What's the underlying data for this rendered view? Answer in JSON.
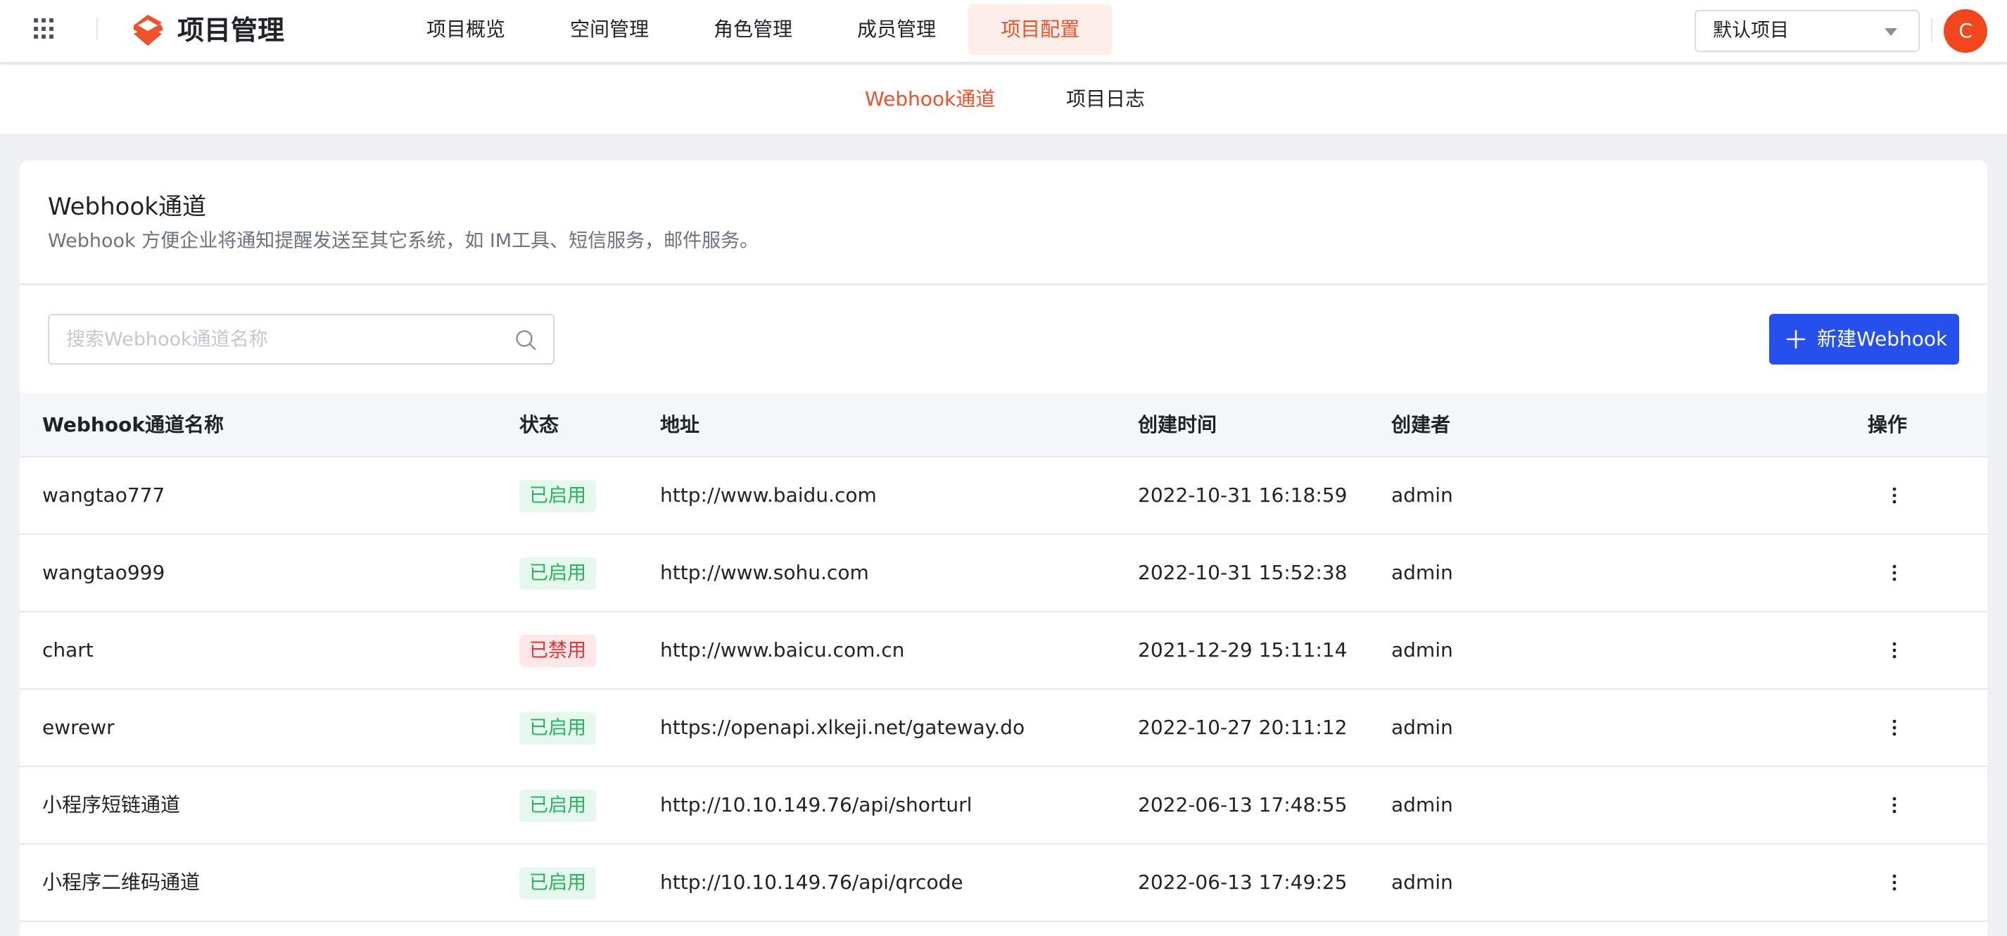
{
  "app": {
    "title": "项目管理",
    "icons": {
      "apps": "apps-grid-icon",
      "logo": "brand-logo-icon"
    },
    "brand_color": "#f0502a",
    "primary_color": "#2550eb"
  },
  "main_nav": [
    {
      "label": "项目概览",
      "active": false
    },
    {
      "label": "空间管理",
      "active": false
    },
    {
      "label": "角色管理",
      "active": false
    },
    {
      "label": "成员管理",
      "active": false
    },
    {
      "label": "项目配置",
      "active": true
    }
  ],
  "project_select": {
    "value": "默认项目",
    "icon": "chevron-down-icon"
  },
  "user": {
    "avatar_letter": "C",
    "avatar_color": "#f2461d"
  },
  "sub_nav": [
    {
      "label": "Webhook通道",
      "active": true
    },
    {
      "label": "项目日志",
      "active": false
    }
  ],
  "page": {
    "title": "Webhook通道",
    "description": "Webhook 方便企业将通知提醒发送至其它系统，如 IM工具、短信服务，邮件服务。"
  },
  "search": {
    "placeholder": "搜索Webhook通道名称",
    "value": "",
    "icon": "search-icon"
  },
  "new_button": {
    "label": "新建Webhook",
    "icon": "plus-icon"
  },
  "table": {
    "columns": [
      "Webhook通道名称",
      "状态",
      "地址",
      "创建时间",
      "创建者",
      "操作"
    ],
    "rows": [
      {
        "name": "wangtao777",
        "status": "已启用",
        "enabled": true,
        "url": "http://www.baidu.com",
        "created": "2022-10-31 16:18:59",
        "creator": "admin"
      },
      {
        "name": "wangtao999",
        "status": "已启用",
        "enabled": true,
        "url": "http://www.sohu.com",
        "created": "2022-10-31 15:52:38",
        "creator": "admin"
      },
      {
        "name": "chart",
        "status": "已禁用",
        "enabled": false,
        "url": "http://www.baicu.com.cn",
        "created": "2021-12-29 15:11:14",
        "creator": "admin"
      },
      {
        "name": "ewrewr",
        "status": "已启用",
        "enabled": true,
        "url": "https://openapi.xlkeji.net/gateway.do",
        "created": "2022-10-27 20:11:12",
        "creator": "admin"
      },
      {
        "name": "小程序短链通道",
        "status": "已启用",
        "enabled": true,
        "url": "http://10.10.149.76/api/shorturl",
        "created": "2022-06-13 17:48:55",
        "creator": "admin"
      },
      {
        "name": "小程序二维码通道",
        "status": "已启用",
        "enabled": true,
        "url": "http://10.10.149.76/api/qrcode",
        "created": "2022-06-13 17:49:25",
        "creator": "admin"
      }
    ],
    "row_action_icon": "more-vertical-icon"
  }
}
